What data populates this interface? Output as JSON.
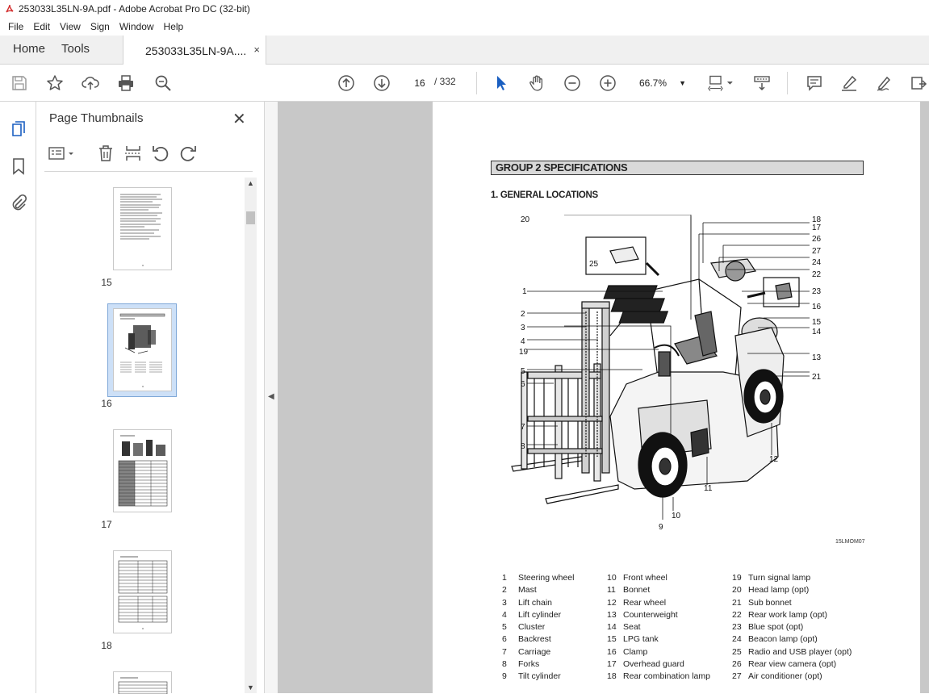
{
  "window": {
    "title": "253033L35LN-9A.pdf - Adobe Acrobat Pro DC (32-bit)"
  },
  "menu": [
    "File",
    "Edit",
    "View",
    "Sign",
    "Window",
    "Help"
  ],
  "tabs": {
    "home": "Home",
    "tools": "Tools",
    "document": "253033L35LN-9A....",
    "close": "×"
  },
  "toolbar": {
    "page_current": "16",
    "page_total": "/ 332",
    "zoom": "66.7%"
  },
  "panel": {
    "title": "Page Thumbnails",
    "close": "✕",
    "thumbnails": [
      {
        "label": "15"
      },
      {
        "label": "16"
      },
      {
        "label": "17"
      },
      {
        "label": "18"
      }
    ]
  },
  "document": {
    "group_title": "GROUP 2  SPECIFICATIONS",
    "section_title": "1. GENERAL LOCATIONS",
    "figure_code": "15LMOM07",
    "callouts": [
      "1",
      "2",
      "3",
      "4",
      "5",
      "6",
      "7",
      "8",
      "9",
      "10",
      "11",
      "12",
      "13",
      "14",
      "15",
      "16",
      "17",
      "18",
      "19",
      "20",
      "21",
      "22",
      "23",
      "24",
      "25",
      "26",
      "27"
    ],
    "legend": [
      [
        {
          "n": "1",
          "t": "Steering wheel"
        },
        {
          "n": "2",
          "t": "Mast"
        },
        {
          "n": "3",
          "t": "Lift chain"
        },
        {
          "n": "4",
          "t": "Lift cylinder"
        },
        {
          "n": "5",
          "t": "Cluster"
        },
        {
          "n": "6",
          "t": "Backrest"
        },
        {
          "n": "7",
          "t": "Carriage"
        },
        {
          "n": "8",
          "t": "Forks"
        },
        {
          "n": "9",
          "t": "Tilt cylinder"
        }
      ],
      [
        {
          "n": "10",
          "t": "Front wheel"
        },
        {
          "n": "11",
          "t": "Bonnet"
        },
        {
          "n": "12",
          "t": "Rear wheel"
        },
        {
          "n": "13",
          "t": "Counterweight"
        },
        {
          "n": "14",
          "t": "Seat"
        },
        {
          "n": "15",
          "t": "LPG tank"
        },
        {
          "n": "16",
          "t": "Clamp"
        },
        {
          "n": "17",
          "t": "Overhead guard"
        },
        {
          "n": "18",
          "t": "Rear combination lamp"
        }
      ],
      [
        {
          "n": "19",
          "t": "Turn signal lamp"
        },
        {
          "n": "20",
          "t": "Head lamp (opt)"
        },
        {
          "n": "21",
          "t": "Sub bonnet"
        },
        {
          "n": "22",
          "t": "Rear work lamp (opt)"
        },
        {
          "n": "23",
          "t": "Blue spot (opt)"
        },
        {
          "n": "24",
          "t": "Beacon lamp (opt)"
        },
        {
          "n": "25",
          "t": "Radio and USB player (opt)"
        },
        {
          "n": "26",
          "t": "Rear view camera (opt)"
        },
        {
          "n": "27",
          "t": "Air conditioner (opt)"
        }
      ]
    ]
  }
}
